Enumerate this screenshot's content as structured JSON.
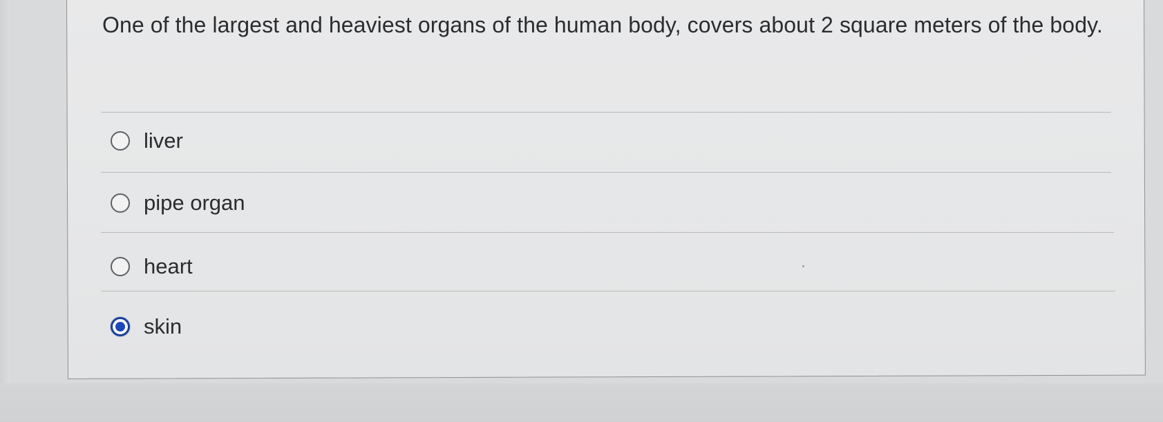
{
  "question": {
    "text": "One of the largest and heaviest organs of the human body, covers about 2 square meters of the body."
  },
  "options": [
    {
      "label": "liver",
      "selected": false
    },
    {
      "label": "pipe organ",
      "selected": false
    },
    {
      "label": "heart",
      "selected": false
    },
    {
      "label": "skin",
      "selected": true
    }
  ],
  "colors": {
    "selected_accent": "#1d49b8",
    "text": "#2b2c2e",
    "background": "#e7e8e9"
  }
}
